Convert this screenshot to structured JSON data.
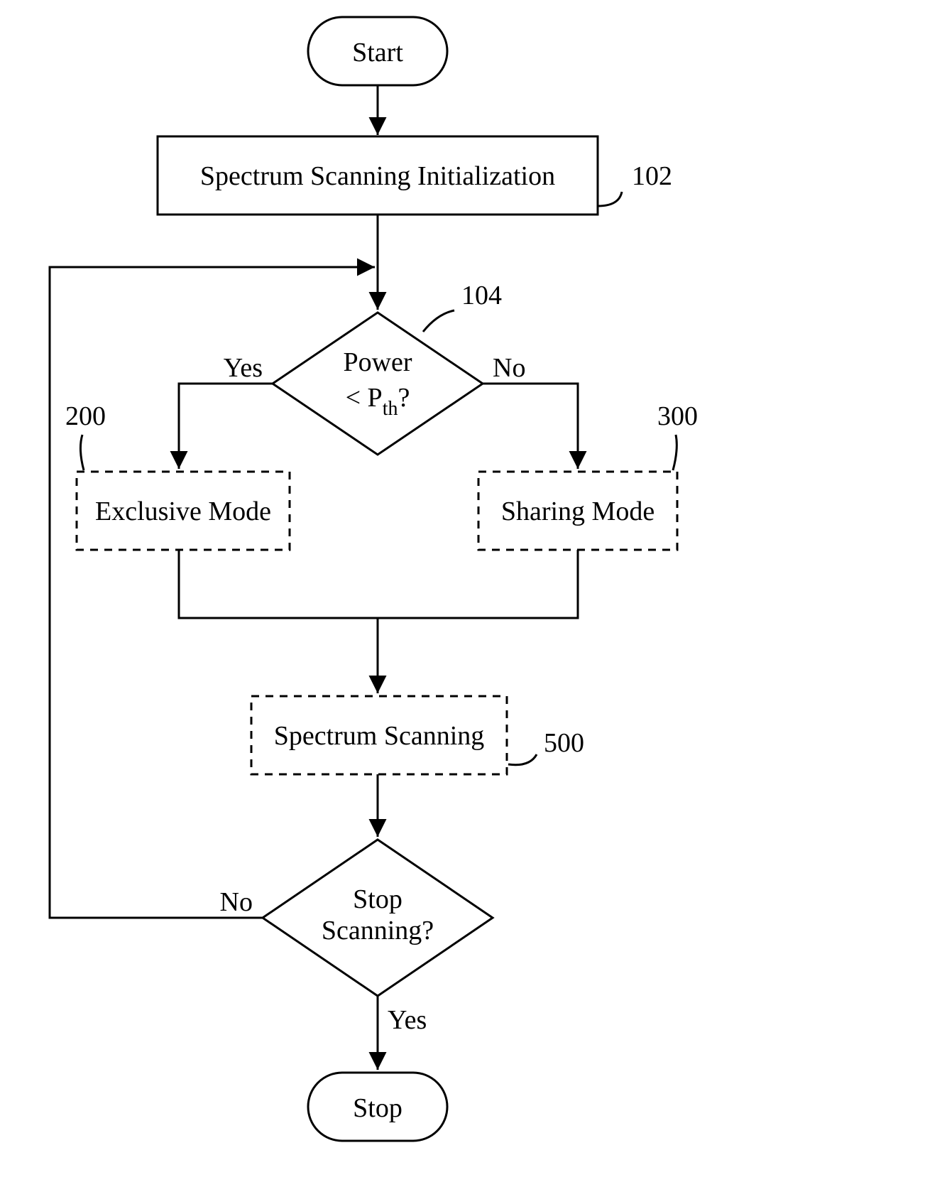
{
  "nodes": {
    "start": {
      "label": "Start"
    },
    "init": {
      "label": "Spectrum Scanning Initialization",
      "ref": "102"
    },
    "power": {
      "line1": "Power",
      "line2_pre": "< P",
      "line2_sub": "th",
      "line2_post": "?",
      "ref": "104"
    },
    "exclusive": {
      "label": "Exclusive Mode",
      "ref": "200"
    },
    "sharing": {
      "label": "Sharing Mode",
      "ref": "300"
    },
    "spectrum": {
      "label": "Spectrum Scanning",
      "ref": "500"
    },
    "stopq": {
      "line1": "Stop",
      "line2": "Scanning?"
    },
    "stop": {
      "label": "Stop"
    }
  },
  "edges": {
    "power_yes": "Yes",
    "power_no": "No",
    "stop_yes": "Yes",
    "stop_no": "No"
  }
}
